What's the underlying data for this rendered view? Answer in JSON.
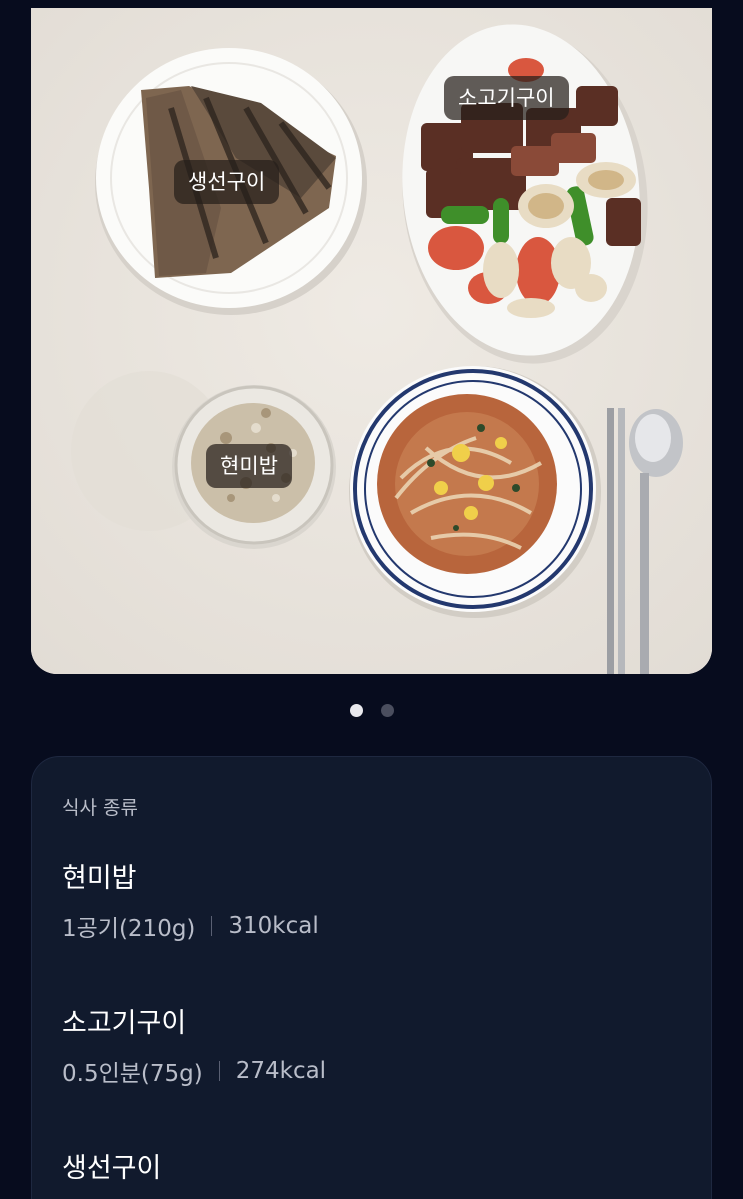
{
  "photo": {
    "tags": [
      "소고기구이",
      "생선구이",
      "현미밥"
    ]
  },
  "pager": {
    "current": 1,
    "total": 2
  },
  "meal": {
    "type_label": "식사 종류",
    "items": [
      {
        "name": "현미밥",
        "amount": "1공기(210g)",
        "calories": "310kcal"
      },
      {
        "name": "소고기구이",
        "amount": "0.5인분(75g)",
        "calories": "274kcal"
      },
      {
        "name": "생선구이"
      }
    ]
  },
  "colors": {
    "background": "#070c1e",
    "card": "#111a2d",
    "secondary_text": "#b9bdc9",
    "dot_active": "#e9e9ee",
    "dot_inactive": "#4a4e5e"
  }
}
